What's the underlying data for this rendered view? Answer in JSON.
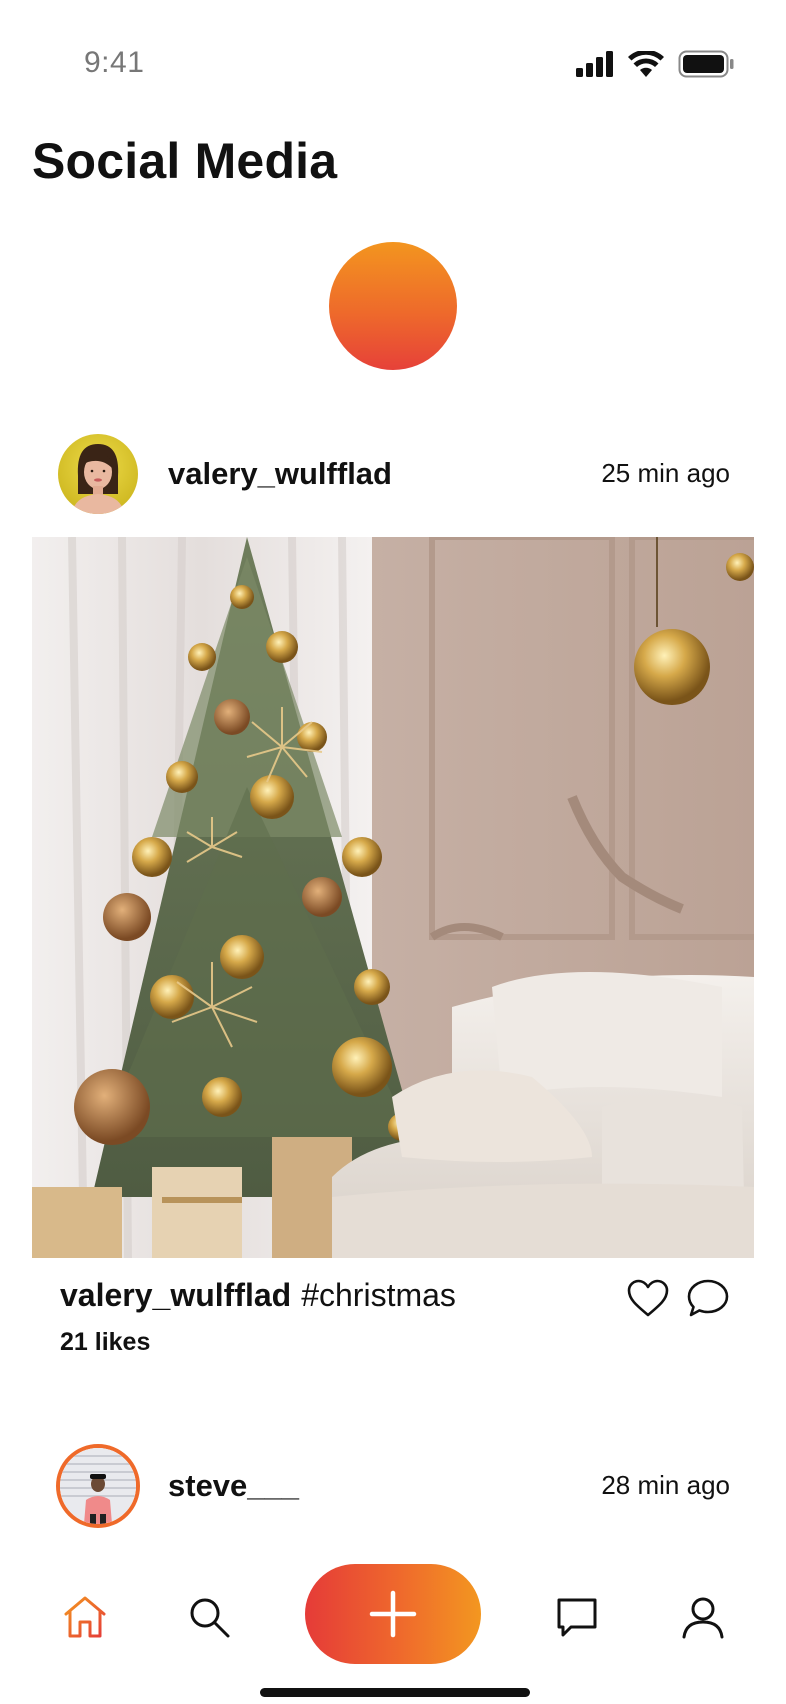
{
  "status_bar": {
    "time": "9:41",
    "icons": [
      "signal-icon",
      "wifi-icon",
      "battery-icon"
    ]
  },
  "page": {
    "title": "Social Media"
  },
  "colors": {
    "accent_start": "#e53b38",
    "accent_end": "#f39720",
    "text": "#111111"
  },
  "posts": [
    {
      "username": "valery_wulfflad",
      "time": "25 min ago",
      "caption_user": "valery_wulfflad",
      "caption_tag": "#christmas",
      "likes": "21 likes"
    },
    {
      "username": "steve___",
      "time": "28 min ago"
    }
  ],
  "nav": {
    "items": [
      "home-icon",
      "search-icon",
      "add-icon",
      "chat-icon",
      "profile-icon"
    ],
    "active": "home-icon"
  }
}
